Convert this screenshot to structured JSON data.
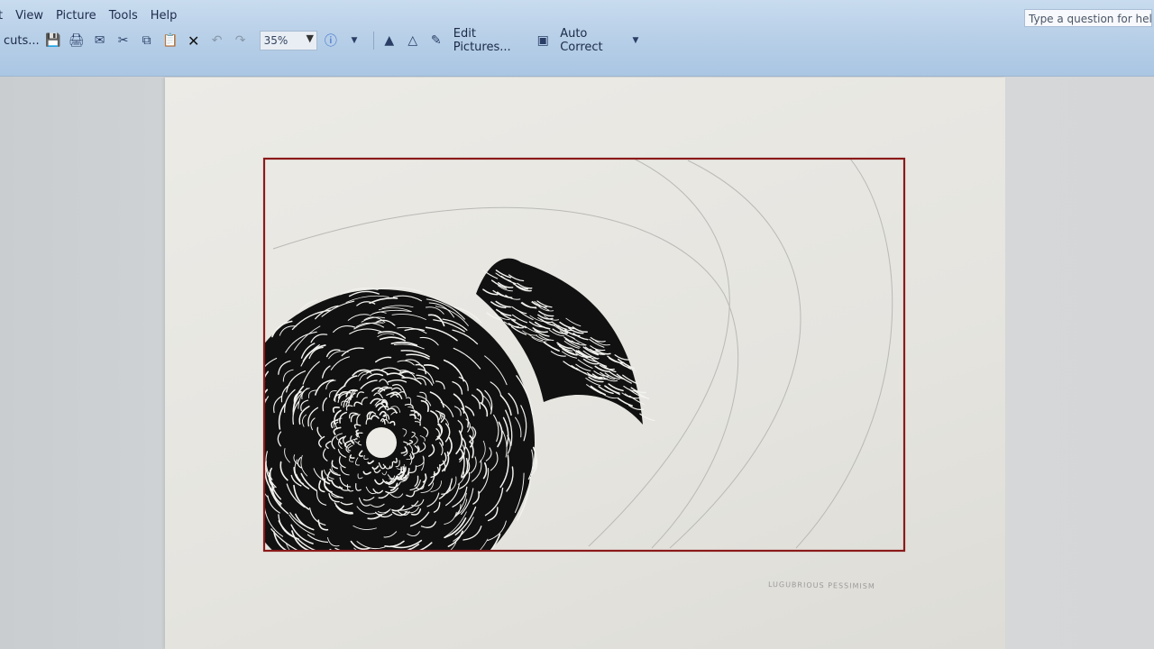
{
  "menu": {
    "items": [
      {
        "label": "t"
      },
      {
        "label": "View"
      },
      {
        "label": "Picture"
      },
      {
        "label": "Tools"
      },
      {
        "label": "Help"
      }
    ]
  },
  "help_box": {
    "placeholder": "Type a question for help"
  },
  "toolbar": {
    "left_fragment": "cuts...",
    "zoom_value": "35%",
    "edit_pictures_label": "Edit Pictures...",
    "auto_correct_label": "Auto Correct"
  },
  "artwork": {
    "signature": "LUGUBRIOUS PESSIMISM",
    "frame_color": "#8b1a1a",
    "ink_color": "#111111"
  }
}
